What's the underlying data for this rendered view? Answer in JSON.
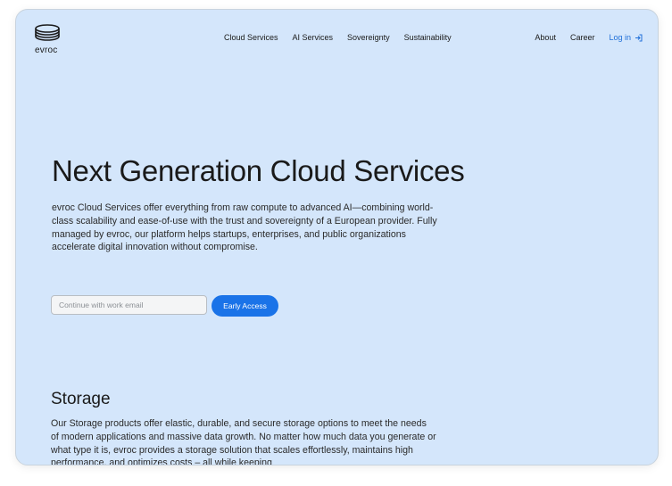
{
  "header": {
    "logo_text": "evroc",
    "nav_center": [
      "Cloud Services",
      "AI Services",
      "Sovereignty",
      "Sustainability"
    ],
    "nav_right": [
      "About",
      "Career"
    ],
    "login_label": "Log in"
  },
  "hero": {
    "title": "Next Generation Cloud Services",
    "description": "evroc Cloud Services offer everything from raw compute to advanced AI—combining world-class scalability and ease-of-use with the trust and sovereignty of a European provider. Fully managed by evroc, our platform helps startups, enterprises, and public organizations accelerate digital innovation without compromise.",
    "email_placeholder": "Continue with work email",
    "email_value": "",
    "cta_label": "Early Access"
  },
  "storage": {
    "title": "Storage",
    "description": "Our Storage products offer elastic, durable, and secure storage options to meet the needs of modern applications and massive data growth. No matter how much data you generate or what type it is, evroc provides a storage solution that scales effortlessly, maintains high performance, and optimizes costs – all while keeping"
  },
  "colors": {
    "background": "#d4e6fb",
    "accent": "#1a73e8",
    "login_link": "#1f6fd8",
    "text": "#1a1a1a"
  },
  "icons": {
    "logo": "evroc-stack-logo-icon",
    "login": "login-arrow-icon"
  }
}
